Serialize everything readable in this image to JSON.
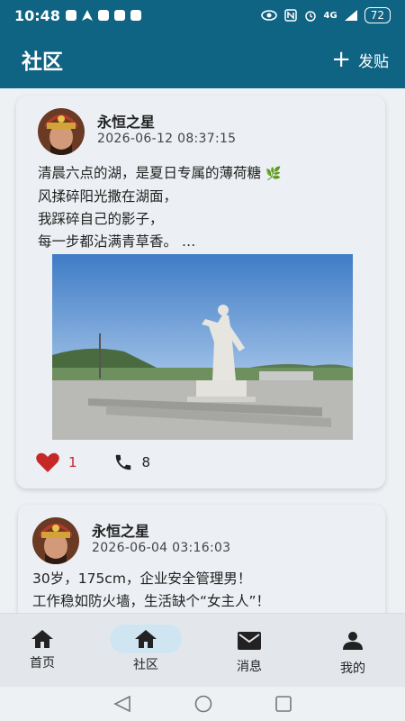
{
  "status_bar": {
    "time": "10:48",
    "network": "4G",
    "battery": "72",
    "icons": [
      "tiktok-icon",
      "navigation-icon",
      "eye-icon",
      "nfc-icon",
      "alarm-icon",
      "signal-icon",
      "battery-icon"
    ]
  },
  "header": {
    "title": "社区",
    "post_label": "发贴",
    "post_icon": "plus-icon",
    "color": "#0f6383"
  },
  "posts": [
    {
      "username": "永恒之星",
      "time": "2026-06-12 08:37:15",
      "lines": [
        "清晨六点的湖，是夏日专属的薄荷糖",
        "风揉碎阳光撒在湖面，",
        "我踩碎自己的影子，",
        "每一步都沾满青草香。 …"
      ],
      "likes": "1",
      "calls": "8"
    },
    {
      "username": "永恒之星",
      "time": "2026-06-04 03:16:03",
      "lines": [
        "30岁，175cm，企业安全管理男！",
        "工作稳如防火墙，生活缺个“女主人”！"
      ]
    }
  ],
  "bottom_nav": [
    {
      "label": "首页",
      "icon": "home-icon",
      "active": false
    },
    {
      "label": "社区",
      "icon": "home-icon",
      "active": true
    },
    {
      "label": "消息",
      "icon": "mail-icon",
      "active": false
    },
    {
      "label": "我的",
      "icon": "person-icon",
      "active": false
    }
  ],
  "colors": {
    "accent": "#0f6383",
    "like": "#c62828",
    "active_pill": "#cfe6f2"
  }
}
